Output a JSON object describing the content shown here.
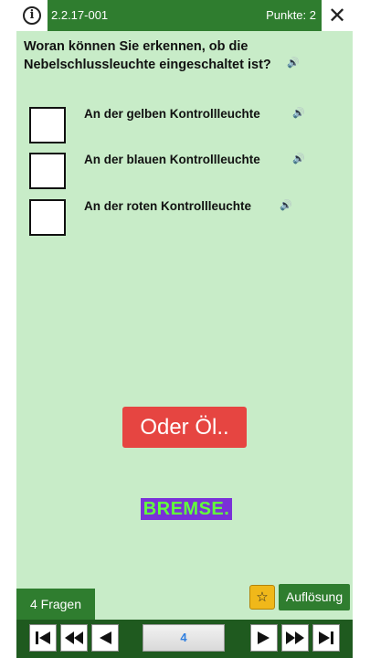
{
  "header": {
    "question_id": "2.2.17-001",
    "points": "Punkte: 2",
    "info_icon": "info-icon",
    "close_icon": "close-icon",
    "close_glyph": "✕",
    "info_glyph": "i"
  },
  "question": {
    "text": "Woran können Sie erkennen, ob die Nebelschlussleuchte eingeschaltet ist?",
    "speaker_glyph": "🔊"
  },
  "answers": [
    {
      "label": "An der gelben Kontrollleuchte",
      "checked": false
    },
    {
      "label": "An der blauen Kontrollleuchte",
      "checked": false
    },
    {
      "label": "An der roten Kontrollleuchte",
      "checked": false
    }
  ],
  "overlay": {
    "toast": "Oder Öl..",
    "sticker": "BREMSE."
  },
  "footer": {
    "question_count": "4 Fragen",
    "star_glyph": "☆",
    "solution_label": "Auflösung",
    "current_page": "4"
  },
  "colors": {
    "bar_green": "#2f7d2f",
    "background_green": "#c8ecc8",
    "toast_red": "#e64541",
    "star_yellow": "#f0b81a",
    "sticker_purple": "#7a31d8",
    "sticker_text": "#62ff3c",
    "page_number_blue": "#2f7fe0"
  }
}
